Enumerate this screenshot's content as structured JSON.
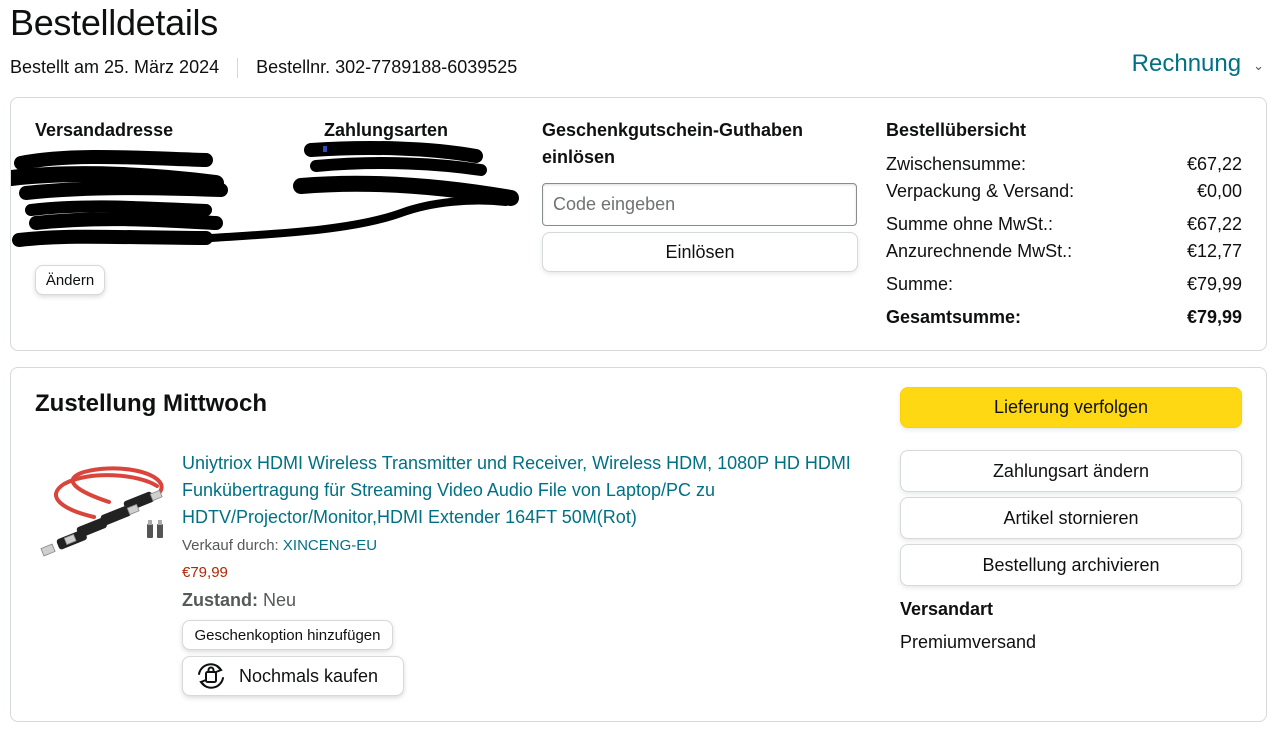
{
  "header": {
    "title": "Bestelldetails",
    "order_date": "Bestellt am 25. März 2024",
    "order_number": "Bestellnr. 302-7789188-6039525",
    "invoice_label": "Rechnung"
  },
  "overview": {
    "shipping_address_heading": "Versandadresse",
    "change_label": "Ändern",
    "payment_heading": "Zahlungsarten",
    "gift_card_heading": "Geschenkgutschein-Guthaben einlösen",
    "code_placeholder": "Code eingeben",
    "redeem_label": "Einlösen",
    "summary_heading": "Bestellübersicht",
    "summary": [
      {
        "label": "Zwischensumme:",
        "value": "€67,22"
      },
      {
        "label": "Verpackung & Versand:",
        "value": "€0,00"
      },
      {
        "label": "Summe ohne MwSt.:",
        "value": "€67,22"
      },
      {
        "label": "Anzurechnende MwSt.:",
        "value": "€12,77"
      },
      {
        "label": "Summe:",
        "value": "€79,99"
      },
      {
        "label": "Gesamtsumme:",
        "value": "€79,99"
      }
    ]
  },
  "delivery": {
    "title": "Zustellung Mittwoch",
    "product_title": "Uniytriox HDMI Wireless Transmitter und Receiver, Wireless HDM, 1080P HD HDMI Funkübertragung für Streaming Video Audio File von Laptop/PC zu HDTV/Projector/Monitor,HDMI Extender 164FT 50M(Rot)",
    "sold_by_prefix": "Verkauf durch: ",
    "seller": "XINCENG-EU",
    "price": "€79,99",
    "condition_label": "Zustand:",
    "condition_value": "Neu",
    "gift_option_label": "Geschenkoption hinzufügen",
    "buy_again_label": "Nochmals kaufen",
    "actions": {
      "track": "Lieferung verfolgen",
      "change_payment": "Zahlungsart ändern",
      "cancel": "Artikel stornieren",
      "archive": "Bestellung archivieren"
    },
    "shipping_method_heading": "Versandart",
    "shipping_method": "Premiumversand"
  },
  "colors": {
    "link": "#007185",
    "price": "#b12704",
    "primary_button": "#ffd814",
    "border": "#d5d9d9"
  },
  "icons": {
    "invoice_chevron": "chevron-down-icon",
    "buy_again": "repeat-bag-icon"
  }
}
